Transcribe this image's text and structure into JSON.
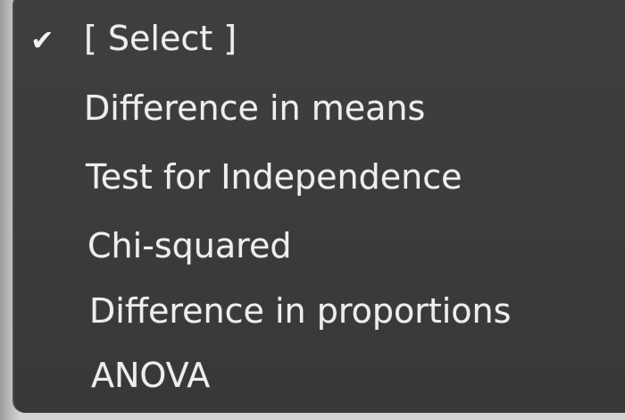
{
  "dropdown": {
    "selected_index": 0,
    "check_icon": "checkmark-icon",
    "options": [
      {
        "label": "[ Select ]",
        "selected": true
      },
      {
        "label": "Difference in means",
        "selected": false
      },
      {
        "label": "Test for Independence",
        "selected": false
      },
      {
        "label": "Chi-squared",
        "selected": false
      },
      {
        "label": "Difference in proportions",
        "selected": false
      },
      {
        "label": "ANOVA",
        "selected": false
      }
    ],
    "colors": {
      "menu_background": "#3a3c3e",
      "text": "#eeeeee"
    }
  }
}
